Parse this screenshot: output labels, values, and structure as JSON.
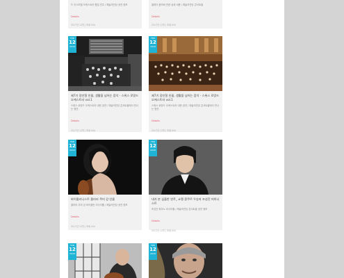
{
  "colors": {
    "accent": "#1fb4d6",
    "link": "#e45a6a",
    "card_bg": "#f1f1f1"
  },
  "cards": [
    {
      "title": "",
      "desc": "드 이스라엘 오케스트라 협업 연주 / 예술의전당 공연 정보",
      "details": "Details",
      "meta": "2017년 12월  |  조회 000",
      "date": {
        "mon": "",
        "day": "",
        "yr": ""
      }
    },
    {
      "title": "",
      "desc": "클래식 음악회 관련 상세 내용 / 예술의전당 콘서트홀",
      "details": "Details",
      "meta": "2017년 12월  |  조회 000",
      "date": {
        "mon": "",
        "day": "",
        "yr": ""
      }
    },
    {
      "title": "제7기 장인철 인물, 생활을 넘어는 음악 - 스위스 로망드 오케스트라 vol.1",
      "desc": "스위스 로망드 오케스트라 내한 공연 / 예술의전당 콘서트홀에서 만나는 명연",
      "details": "Details",
      "meta": "2017년 12월  |  조회 000",
      "date": {
        "mon": "FEB",
        "day": "12",
        "yr": "2018"
      }
    },
    {
      "title": "제7기 장인철 인물, 생활을 넘어는 음악 - 스위스 로망드 오케스트라 vol.1",
      "desc": "스위스 로망드 오케스트라 내한 공연 / 예술의전당 콘서트홀에서 만나는 명연",
      "details": "Details",
      "meta": "2017년 12월  |  조회 000",
      "date": {
        "mon": "FEB",
        "day": "12",
        "yr": "2018"
      }
    },
    {
      "title": "바이올리니스트 클라라 주미 강 인물",
      "desc": "클라라 주미 강 바이올린 리사이틀 / 예술의전당 공연 정보",
      "details": "Details",
      "meta": "2017년 12월  |  조회 000",
      "date": {
        "mon": "FEB",
        "day": "12",
        "yr": "2018"
      }
    },
    {
      "title": "내가 본 심플한 연주_ 쇼팽 콩쿠르 우승자 조성진 피아니스트",
      "desc": "조성진 피아노 리사이틀 / 예술의전당 콘서트홀 공연 정보",
      "details": "Details",
      "meta": "2017년 12월  |  조회 000",
      "date": {
        "mon": "FEB",
        "day": "12",
        "yr": "2018"
      }
    },
    {
      "title": "",
      "desc": "",
      "details": "",
      "meta": "",
      "date": {
        "mon": "FEB",
        "day": "12",
        "yr": "2018"
      }
    },
    {
      "title": "",
      "desc": "",
      "details": "",
      "meta": "",
      "date": {
        "mon": "FEB",
        "day": "12",
        "yr": "2018"
      }
    }
  ]
}
